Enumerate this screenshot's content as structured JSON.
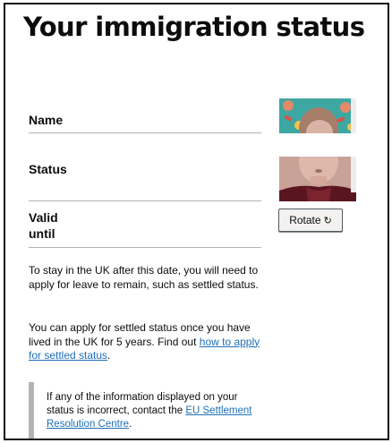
{
  "page": {
    "title": "Your immigration status"
  },
  "summary": {
    "rows": [
      {
        "key": "Name"
      },
      {
        "key": "Status"
      },
      {
        "key": "Valid until"
      }
    ]
  },
  "content": {
    "para1": "To stay in the UK after this date, you will need to apply for leave to remain, such as settled status.",
    "para2_text": "You can apply for settled status once you have lived in the UK for 5 years. Find out ",
    "para2_link": "how to apply for settled status",
    "para2_end": ".",
    "inset_text": "If any of the information displayed on your status is incorrect, contact the ",
    "inset_link": "EU Settlement Resolution Centre",
    "inset_end": "."
  },
  "photo": {
    "rotate_label": "Rotate",
    "rotate_icon": "rotate-icon"
  },
  "colors": {
    "text": "#0b0c0c",
    "link": "#1d70b8",
    "border": "#b1b4b6",
    "button_bg": "#f3f2f1"
  }
}
